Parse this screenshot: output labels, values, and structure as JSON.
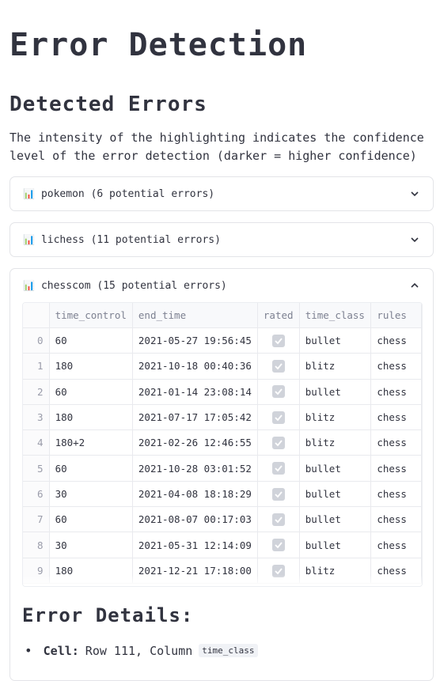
{
  "page": {
    "title": "Error Detection",
    "section_title": "Detected Errors",
    "description": "The intensity of the highlighting indicates the confidence level of the error detection (darker = higher confidence)"
  },
  "expanders": [
    {
      "icon": "📊",
      "label": "pokemon (6 potential errors)",
      "expanded": false
    },
    {
      "icon": "📊",
      "label": "lichess (11 potential errors)",
      "expanded": false
    },
    {
      "icon": "📊",
      "label": "chesscom (15 potential errors)",
      "expanded": true
    }
  ],
  "table": {
    "columns": [
      "",
      "time_control",
      "end_time",
      "rated",
      "time_class",
      "rules"
    ],
    "rows": [
      {
        "idx": "0",
        "time_control": "60",
        "end_time": "2021-05-27 19:56:45",
        "rated": true,
        "time_class": "bullet",
        "rules": "chess"
      },
      {
        "idx": "1",
        "time_control": "180",
        "end_time": "2021-10-18 00:40:36",
        "rated": true,
        "time_class": "blitz",
        "rules": "chess"
      },
      {
        "idx": "2",
        "time_control": "60",
        "end_time": "2021-01-14 23:08:14",
        "rated": true,
        "time_class": "bullet",
        "rules": "chess"
      },
      {
        "idx": "3",
        "time_control": "180",
        "end_time": "2021-07-17 17:05:42",
        "rated": true,
        "time_class": "blitz",
        "rules": "chess"
      },
      {
        "idx": "4",
        "time_control": "180+2",
        "end_time": "2021-02-26 12:46:55",
        "rated": true,
        "time_class": "blitz",
        "rules": "chess"
      },
      {
        "idx": "5",
        "time_control": "60",
        "end_time": "2021-10-28 03:01:52",
        "rated": true,
        "time_class": "bullet",
        "rules": "chess"
      },
      {
        "idx": "6",
        "time_control": "30",
        "end_time": "2021-04-08 18:18:29",
        "rated": true,
        "time_class": "bullet",
        "rules": "chess"
      },
      {
        "idx": "7",
        "time_control": "60",
        "end_time": "2021-08-07 00:17:03",
        "rated": true,
        "time_class": "bullet",
        "rules": "chess"
      },
      {
        "idx": "8",
        "time_control": "30",
        "end_time": "2021-05-31 12:14:09",
        "rated": true,
        "time_class": "bullet",
        "rules": "chess"
      },
      {
        "idx": "9",
        "time_control": "180",
        "end_time": "2021-12-21 17:18:00",
        "rated": true,
        "time_class": "blitz",
        "rules": "chess"
      }
    ]
  },
  "details": {
    "title": "Error Details:",
    "cell_label": "Cell:",
    "cell_text": "Row 111, Column",
    "column_code": "time_class"
  }
}
